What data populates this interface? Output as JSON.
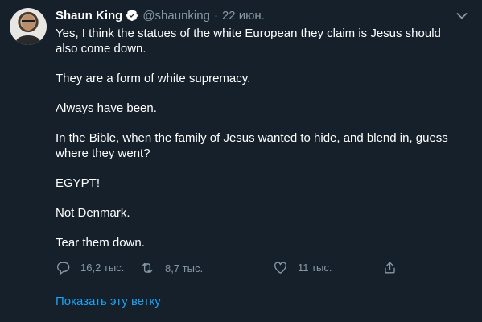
{
  "tweet": {
    "author_name": "Shaun King",
    "handle": "@shaunking",
    "separator": "·",
    "time": "22 июн.",
    "paragraphs": [
      "Yes, I think the statues of the white European they claim is Jesus should also come down.",
      "They are a form of white supremacy.",
      "Always have been.",
      "In the Bible, when the family of Jesus wanted to hide, and blend in, guess where they went?",
      "EGYPT!",
      "Not Denmark.",
      "Tear them down."
    ],
    "actions": {
      "reply_count": "16,2 тыс.",
      "retweet_count": "8,7 тыс.",
      "like_count": "11 тыс."
    },
    "show_thread_label": "Показать эту ветку"
  },
  "icons": {
    "verified": "verified-badge-icon",
    "more": "chevron-down-icon",
    "reply": "reply-icon",
    "retweet": "retweet-icon",
    "like": "heart-icon",
    "share": "share-icon"
  },
  "colors": {
    "background": "#15202b",
    "text": "#ffffff",
    "secondary_text": "#8899a6",
    "accent": "#1da1f2"
  }
}
